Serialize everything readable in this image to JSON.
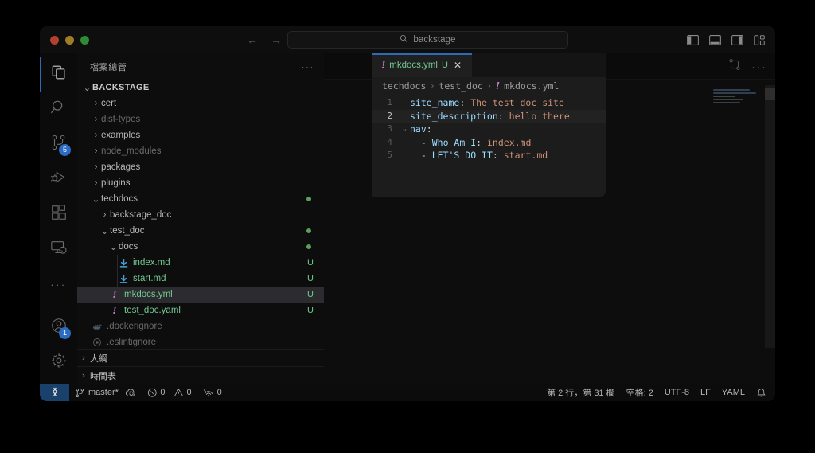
{
  "titlebar": {
    "traffic": [
      "close",
      "minimize",
      "maximize"
    ],
    "back_label": "←",
    "forward_label": "→",
    "search_placeholder": "backstage",
    "search_value": "backstage",
    "search_icon": "search-icon",
    "layout_icons": [
      "toggle-primary-sidebar-icon",
      "toggle-panel-icon",
      "toggle-secondary-sidebar-icon",
      "customize-layout-icon"
    ]
  },
  "activitybar": {
    "items": [
      {
        "name": "explorer",
        "icon": "files-icon",
        "active": true,
        "badge": ""
      },
      {
        "name": "search",
        "icon": "search-icon",
        "active": false,
        "badge": ""
      },
      {
        "name": "source-control",
        "icon": "source-control-icon",
        "active": false,
        "badge": "5"
      },
      {
        "name": "run-and-debug",
        "icon": "run-debug-icon",
        "active": false,
        "badge": ""
      },
      {
        "name": "extensions",
        "icon": "extensions-icon",
        "active": false,
        "badge": ""
      },
      {
        "name": "remote-explorer",
        "icon": "remote-explorer-icon",
        "active": false,
        "badge": ""
      },
      {
        "name": "more-views",
        "icon": "ellipsis-icon",
        "active": false,
        "badge": ""
      }
    ],
    "bottom": [
      {
        "name": "accounts",
        "icon": "account-icon",
        "badge": "1"
      },
      {
        "name": "settings",
        "icon": "gear-icon",
        "badge": ""
      }
    ]
  },
  "sidebar": {
    "title": "檔案總管",
    "more_actions": "···",
    "tree": [
      {
        "label": "BACKSTAGE",
        "depth": 0,
        "type": "root",
        "chev": "⌄",
        "state": "expanded"
      },
      {
        "label": "cert",
        "depth": 1,
        "type": "folder",
        "chev": "›",
        "state": "collapsed"
      },
      {
        "label": "dist-types",
        "depth": 1,
        "type": "folder",
        "chev": "›",
        "state": "collapsed",
        "dim": true
      },
      {
        "label": "examples",
        "depth": 1,
        "type": "folder",
        "chev": "›",
        "state": "collapsed"
      },
      {
        "label": "node_modules",
        "depth": 1,
        "type": "folder",
        "chev": "›",
        "state": "collapsed",
        "dim": true
      },
      {
        "label": "packages",
        "depth": 1,
        "type": "folder",
        "chev": "›",
        "state": "collapsed"
      },
      {
        "label": "plugins",
        "depth": 1,
        "type": "folder",
        "chev": "›",
        "state": "collapsed"
      },
      {
        "label": "techdocs",
        "depth": 1,
        "type": "folder",
        "chev": "⌄",
        "state": "expanded",
        "gitdot": true
      },
      {
        "label": "backstage_doc",
        "depth": 2,
        "type": "folder",
        "chev": "›",
        "state": "collapsed"
      },
      {
        "label": "test_doc",
        "depth": 2,
        "type": "folder",
        "chev": "⌄",
        "state": "expanded",
        "gitdot": true
      },
      {
        "label": "docs",
        "depth": 3,
        "type": "folder",
        "chev": "⌄",
        "state": "expanded",
        "gitdot": true
      },
      {
        "label": "index.md",
        "depth": 4,
        "type": "file",
        "icon": "markdown-icon",
        "status": "U",
        "untracked": true
      },
      {
        "label": "start.md",
        "depth": 4,
        "type": "file",
        "icon": "markdown-icon",
        "status": "U",
        "untracked": true
      },
      {
        "label": "mkdocs.yml",
        "depth": 3,
        "type": "file",
        "icon": "yaml-icon",
        "status": "U",
        "untracked": true,
        "selected": true
      },
      {
        "label": "test_doc.yaml",
        "depth": 3,
        "type": "file",
        "icon": "yaml-icon",
        "status": "U",
        "untracked": true
      },
      {
        "label": ".dockerignore",
        "depth": 1,
        "type": "file",
        "icon": "docker-icon",
        "dim": true
      },
      {
        "label": ".eslintignore",
        "depth": 1,
        "type": "file",
        "icon": "eslint-icon",
        "dim": true
      }
    ],
    "sections": [
      {
        "label": "大綱",
        "chev": "›"
      },
      {
        "label": "時間表",
        "chev": "›"
      }
    ]
  },
  "editor": {
    "background_actions": [
      "compare-changes-icon",
      "more-actions-icon"
    ],
    "overlay": {
      "tab": {
        "icon": "yaml-icon",
        "label": "mkdocs.yml",
        "status": "U",
        "close": "✕"
      },
      "breadcrumb": [
        "techdocs",
        "test_doc",
        "mkdocs.yml"
      ],
      "breadcrumb_sep": "›",
      "lines": [
        {
          "num": "1",
          "fold": "",
          "tokens": [
            {
              "t": "key",
              "s": "site_name"
            },
            {
              "t": "punct",
              "s": ":"
            },
            {
              "t": "plain",
              "s": " "
            },
            {
              "t": "val",
              "s": "The test doc site"
            }
          ]
        },
        {
          "num": "2",
          "fold": "",
          "current": true,
          "tokens": [
            {
              "t": "key",
              "s": "site_description"
            },
            {
              "t": "punct",
              "s": ":"
            },
            {
              "t": "plain",
              "s": " "
            },
            {
              "t": "val",
              "s": "hello there"
            }
          ]
        },
        {
          "num": "3",
          "fold": "⌄",
          "tokens": [
            {
              "t": "key",
              "s": "nav"
            },
            {
              "t": "punct",
              "s": ":"
            }
          ]
        },
        {
          "num": "4",
          "fold": "",
          "tokens": [
            {
              "t": "plain",
              "s": "  "
            },
            {
              "t": "punct",
              "s": "-"
            },
            {
              "t": "plain",
              "s": " "
            },
            {
              "t": "key",
              "s": "Who Am I"
            },
            {
              "t": "punct",
              "s": ":"
            },
            {
              "t": "plain",
              "s": " "
            },
            {
              "t": "val",
              "s": "index.md"
            }
          ]
        },
        {
          "num": "5",
          "fold": "",
          "tokens": [
            {
              "t": "plain",
              "s": "  "
            },
            {
              "t": "punct",
              "s": "-"
            },
            {
              "t": "plain",
              "s": " "
            },
            {
              "t": "key",
              "s": "LET'S DO IT"
            },
            {
              "t": "punct",
              "s": ":"
            },
            {
              "t": "plain",
              "s": " "
            },
            {
              "t": "val",
              "s": "start.md"
            }
          ]
        }
      ]
    }
  },
  "statusbar": {
    "remote_icon": "remote-window-icon",
    "branch_icon": "source-control-icon",
    "branch": "master*",
    "sync_icon": "sync-cloud-icon",
    "error_icon": "error-icon",
    "errors": "0",
    "warning_icon": "warning-icon",
    "warnings": "0",
    "ports_icon": "ports-icon",
    "ports": "0",
    "position": "第 2 行，第 31 欄",
    "indentation": "空格: 2",
    "encoding": "UTF-8",
    "eol": "LF",
    "language": "YAML",
    "bell_icon": "bell-icon"
  },
  "colors": {
    "accent": "#2f6bb5",
    "untracked": "#73c991",
    "badge": "#2a6bc4",
    "remote_bg": "#19416b",
    "yaml_key": "#9cdcfe",
    "yaml_value": "#ce9178"
  }
}
